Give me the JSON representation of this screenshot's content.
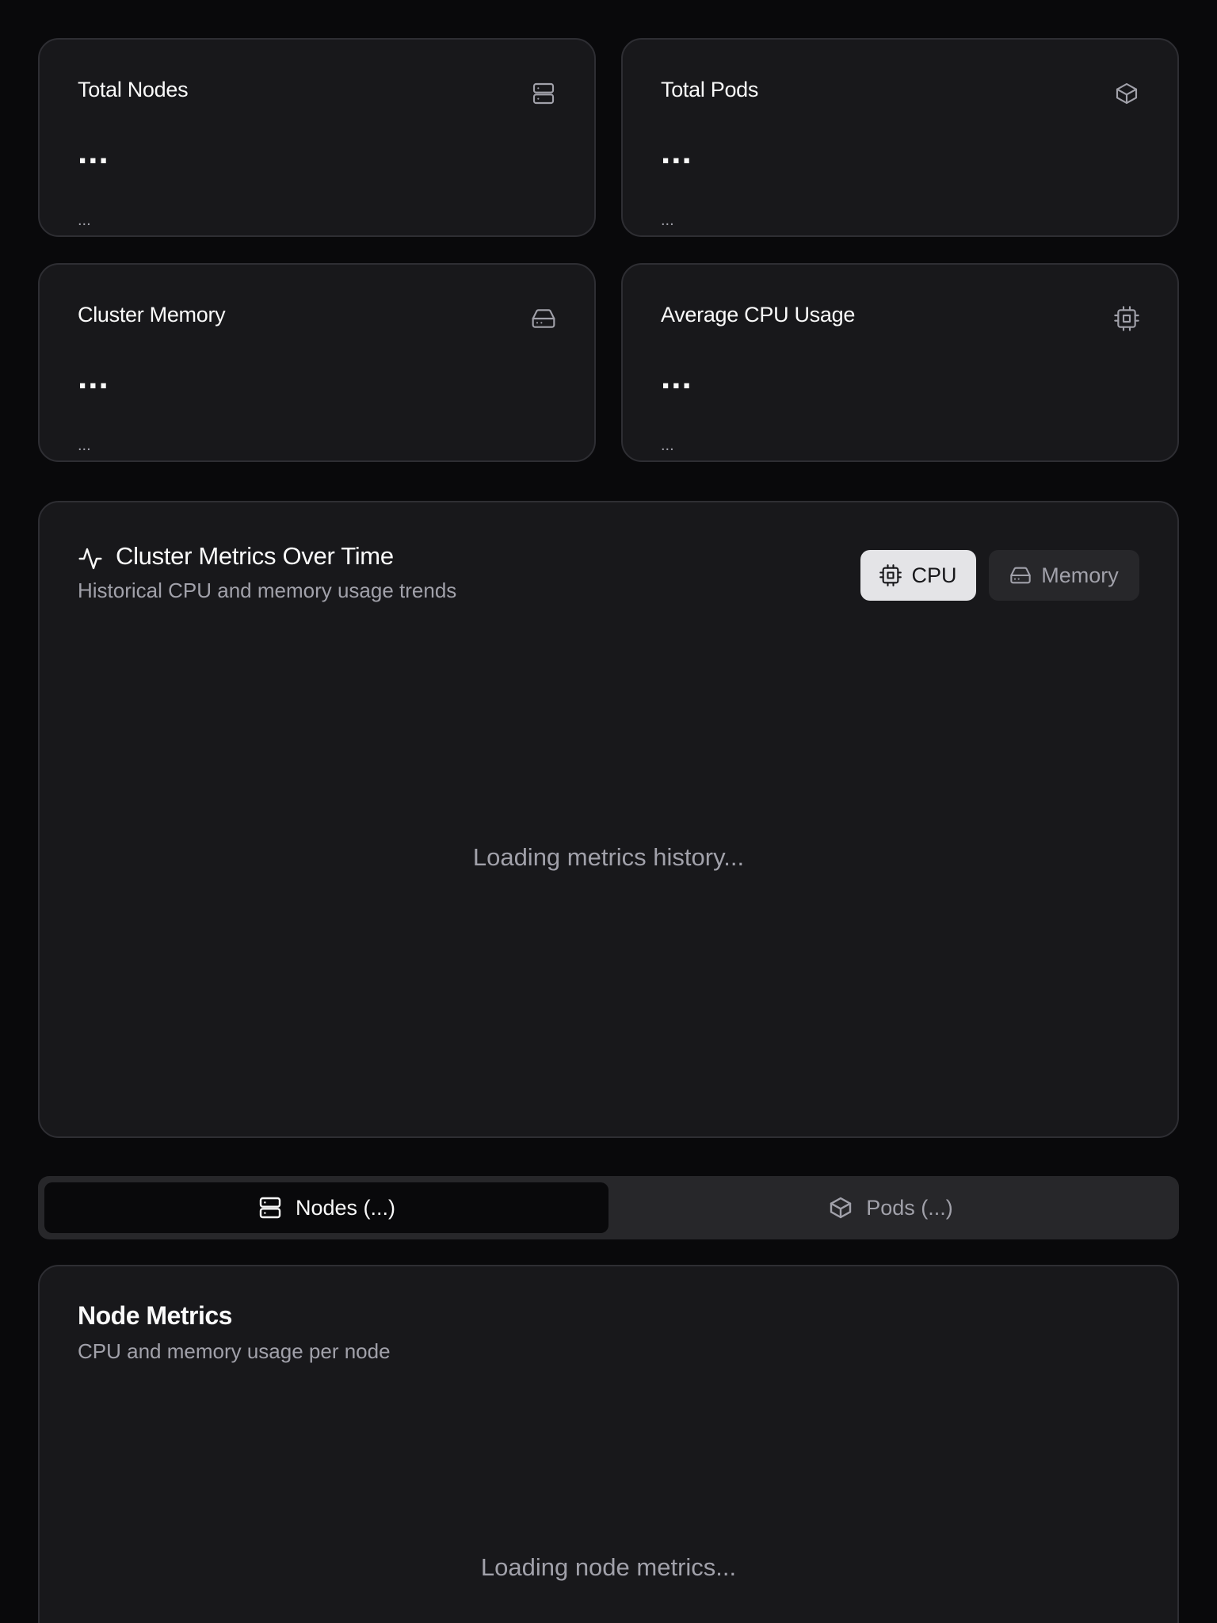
{
  "stats": [
    {
      "title": "Total Nodes",
      "value": "...",
      "sub": "...",
      "icon": "server-icon"
    },
    {
      "title": "Total Pods",
      "value": "...",
      "sub": "...",
      "icon": "package-icon"
    },
    {
      "title": "Cluster Memory",
      "value": "...",
      "sub": "...",
      "icon": "hard-drive-icon"
    },
    {
      "title": "Average CPU Usage",
      "value": "...",
      "sub": "...",
      "icon": "cpu-icon"
    }
  ],
  "metrics": {
    "title": "Cluster Metrics Over Time",
    "subtitle": "Historical CPU and memory usage trends",
    "cpu_label": "CPU",
    "memory_label": "Memory",
    "selected": "CPU",
    "loading": "Loading metrics history..."
  },
  "tabs": {
    "nodes_label": "Nodes (...)",
    "pods_label": "Pods (...)",
    "active": "Nodes"
  },
  "node_metrics": {
    "title": "Node Metrics",
    "subtitle": "CPU and memory usage per node",
    "loading": "Loading node metrics..."
  },
  "colors": {
    "background": "#09090b",
    "card": "#18181b",
    "border": "#2e2e33",
    "muted_text": "#a1a1aa",
    "active_toggle": "#e4e4e7"
  }
}
